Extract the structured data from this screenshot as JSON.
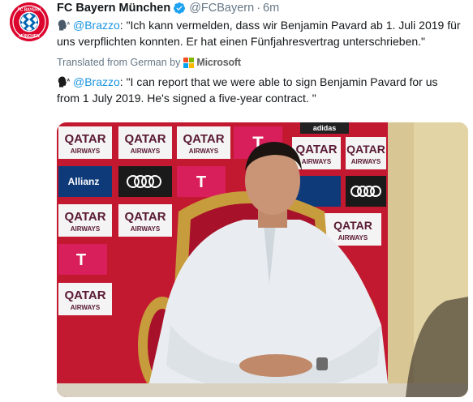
{
  "tweet": {
    "display_name": "FC Bayern München",
    "handle": "@FCBayern",
    "separator": "·",
    "time": "6m",
    "original_mention": "@Brazzo",
    "original_text": ": \"Ich kann vermelden, dass wir Benjamin Pavard ab 1. Juli 2019 für uns verpflichten konnten. Er hat einen Fünfjahresvertrag unterschrieben.\"",
    "translated_from": "Translated from German by",
    "translator_brand": "Microsoft",
    "translation_mention": "@Brazzo",
    "translation_text": ": \"I can report that we were able to sign Benjamin Pavard for us from 1 July 2019. He's signed a five-year contract. \""
  },
  "media": {
    "sponsor_boards": [
      "QATAR",
      "AIRWAYS",
      "Allianz",
      "T",
      "adidas"
    ]
  },
  "colors": {
    "bayern_red": "#dc052d",
    "verified_blue": "#1da1f2",
    "link_blue": "#1b95e0",
    "muted_gray": "#657786"
  },
  "icons": {
    "avatar": "fc-bayern-logo",
    "verified": "verified-badge-icon",
    "speaking_head": "speaking-head-icon",
    "microsoft": "microsoft-logo"
  }
}
